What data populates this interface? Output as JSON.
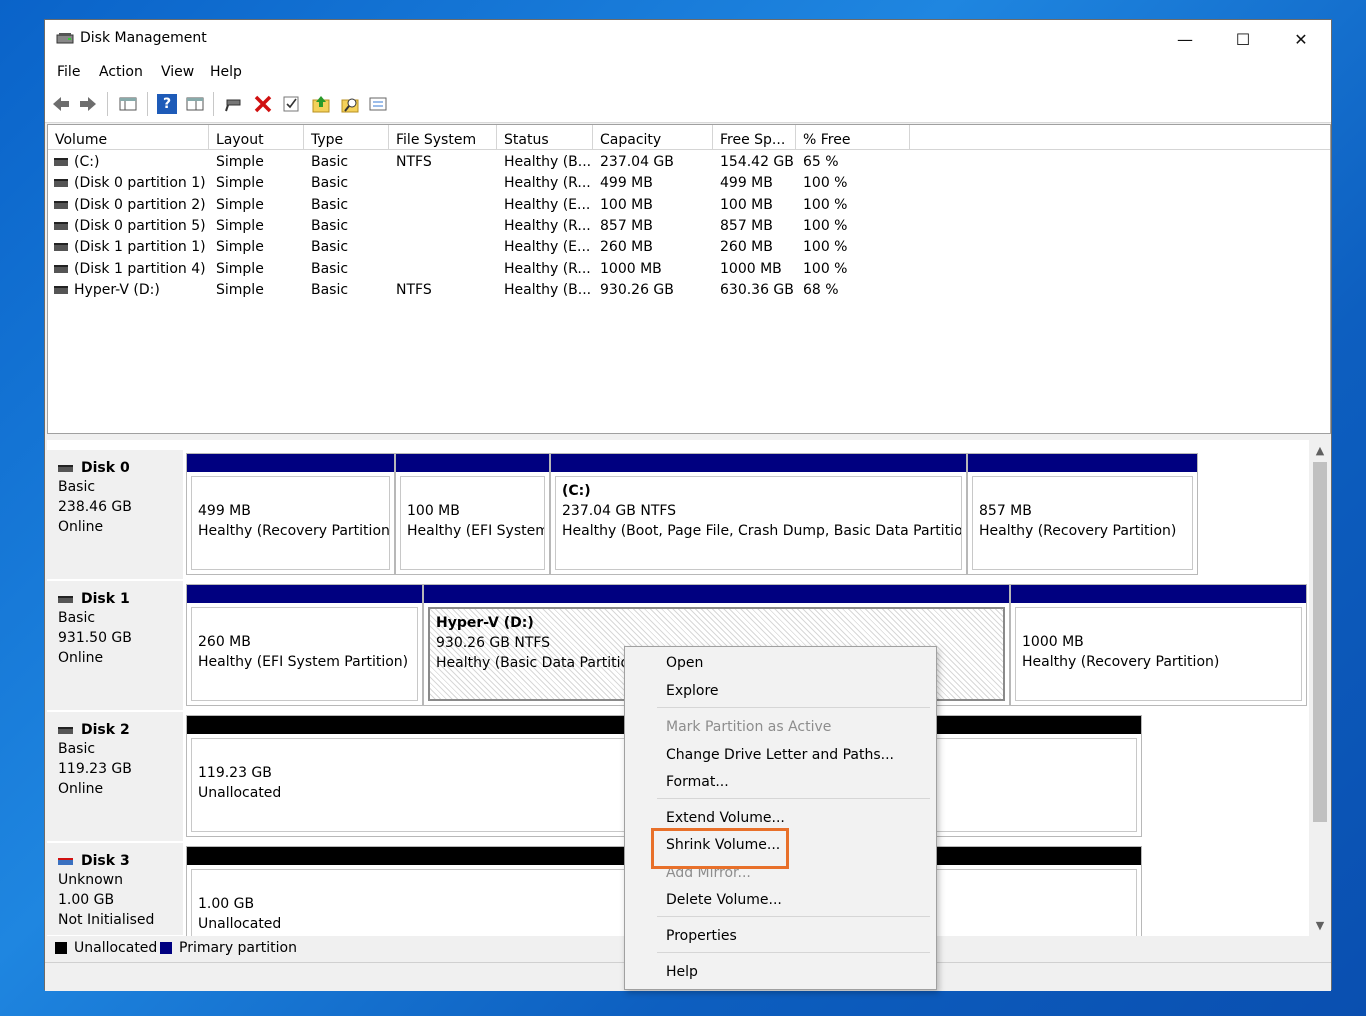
{
  "window": {
    "title": "Disk Management",
    "minimize": "—",
    "maximize": "☐",
    "close": "✕"
  },
  "menu": {
    "file": "File",
    "action": "Action",
    "view": "View",
    "help": "Help"
  },
  "toolbar": {
    "back": "back-arrow",
    "forward": "forward-arrow",
    "help_glyph": "?"
  },
  "volume_list": {
    "headers": [
      "Volume",
      "Layout",
      "Type",
      "File System",
      "Status",
      "Capacity",
      "Free Sp...",
      "% Free"
    ],
    "rows": [
      {
        "volume": "(C:)",
        "layout": "Simple",
        "type": "Basic",
        "fs": "NTFS",
        "status": "Healthy (B...",
        "capacity": "237.04 GB",
        "free": "154.42 GB",
        "pct": "65 %"
      },
      {
        "volume": "(Disk 0 partition 1)",
        "layout": "Simple",
        "type": "Basic",
        "fs": "",
        "status": "Healthy (R...",
        "capacity": "499 MB",
        "free": "499 MB",
        "pct": "100 %"
      },
      {
        "volume": "(Disk 0 partition 2)",
        "layout": "Simple",
        "type": "Basic",
        "fs": "",
        "status": "Healthy (E...",
        "capacity": "100 MB",
        "free": "100 MB",
        "pct": "100 %"
      },
      {
        "volume": "(Disk 0 partition 5)",
        "layout": "Simple",
        "type": "Basic",
        "fs": "",
        "status": "Healthy (R...",
        "capacity": "857 MB",
        "free": "857 MB",
        "pct": "100 %"
      },
      {
        "volume": "(Disk 1 partition 1)",
        "layout": "Simple",
        "type": "Basic",
        "fs": "",
        "status": "Healthy (E...",
        "capacity": "260 MB",
        "free": "260 MB",
        "pct": "100 %"
      },
      {
        "volume": "(Disk 1 partition 4)",
        "layout": "Simple",
        "type": "Basic",
        "fs": "",
        "status": "Healthy (R...",
        "capacity": "1000 MB",
        "free": "1000 MB",
        "pct": "100 %"
      },
      {
        "volume": "Hyper-V (D:)",
        "layout": "Simple",
        "type": "Basic",
        "fs": "NTFS",
        "status": "Healthy (B...",
        "capacity": "930.26 GB",
        "free": "630.36 GB",
        "pct": "68 %"
      }
    ]
  },
  "disks": [
    {
      "name": "Disk 0",
      "type": "Basic",
      "size": "238.46 GB",
      "state": "Online",
      "partitions": [
        {
          "title": "",
          "size": "499 MB",
          "status": "Healthy (Recovery Partition)"
        },
        {
          "title": "",
          "size": "100 MB",
          "status": "Healthy (EFI System"
        },
        {
          "title": "(C:)",
          "size": "237.04 GB NTFS",
          "status": "Healthy (Boot, Page File, Crash Dump, Basic Data Partition)"
        },
        {
          "title": "",
          "size": "857 MB",
          "status": "Healthy (Recovery Partition)"
        }
      ]
    },
    {
      "name": "Disk 1",
      "type": "Basic",
      "size": "931.50 GB",
      "state": "Online",
      "partitions": [
        {
          "title": "",
          "size": "260 MB",
          "status": "Healthy (EFI System Partition)"
        },
        {
          "title": "Hyper-V  (D:)",
          "size": "930.26 GB NTFS",
          "status": "Healthy (Basic Data Partition)"
        },
        {
          "title": "",
          "size": "1000 MB",
          "status": "Healthy (Recovery Partition)"
        }
      ]
    },
    {
      "name": "Disk 2",
      "type": "Basic",
      "size": "119.23 GB",
      "state": "Online",
      "partitions": [
        {
          "title": "",
          "size": "119.23 GB",
          "status": "Unallocated"
        }
      ]
    },
    {
      "name": "Disk 3",
      "type": "Unknown",
      "size": "1.00 GB",
      "state": "Not Initialised",
      "partitions": [
        {
          "title": "",
          "size": "1.00 GB",
          "status": "Unallocated"
        }
      ]
    }
  ],
  "legend": {
    "unallocated": "Unallocated",
    "primary": "Primary partition"
  },
  "context_menu": {
    "open": "Open",
    "explore": "Explore",
    "mark_active": "Mark Partition as Active",
    "change_letter": "Change Drive Letter and Paths...",
    "format": "Format...",
    "extend": "Extend Volume...",
    "shrink": "Shrink Volume...",
    "add_mirror": "Add Mirror...",
    "delete": "Delete Volume...",
    "properties": "Properties",
    "help": "Help"
  },
  "colors": {
    "primary_bar": "#000080",
    "unallocated_bar": "#000000",
    "highlight": "#e8702a"
  }
}
